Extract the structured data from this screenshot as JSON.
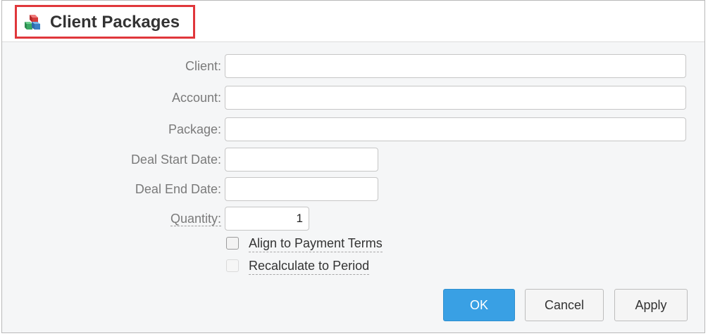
{
  "dialog": {
    "title": "Client Packages",
    "icon": "packages-cube-icon"
  },
  "form": {
    "client_label": "Client:",
    "client_value": "",
    "account_label": "Account:",
    "account_value": "",
    "package_label": "Package:",
    "package_value": "",
    "deal_start_label": "Deal Start Date:",
    "deal_start_value": "",
    "deal_end_label": "Deal End Date:",
    "deal_end_value": "",
    "quantity_label": "Quantity:",
    "quantity_value": "1",
    "align_label": "Align to Payment Terms",
    "align_checked": false,
    "recalc_label": "Recalculate to Period",
    "recalc_checked": false,
    "recalc_disabled": true
  },
  "buttons": {
    "ok": "OK",
    "cancel": "Cancel",
    "apply": "Apply"
  },
  "colors": {
    "highlight": "#e0373b",
    "primary": "#39a0e4"
  }
}
